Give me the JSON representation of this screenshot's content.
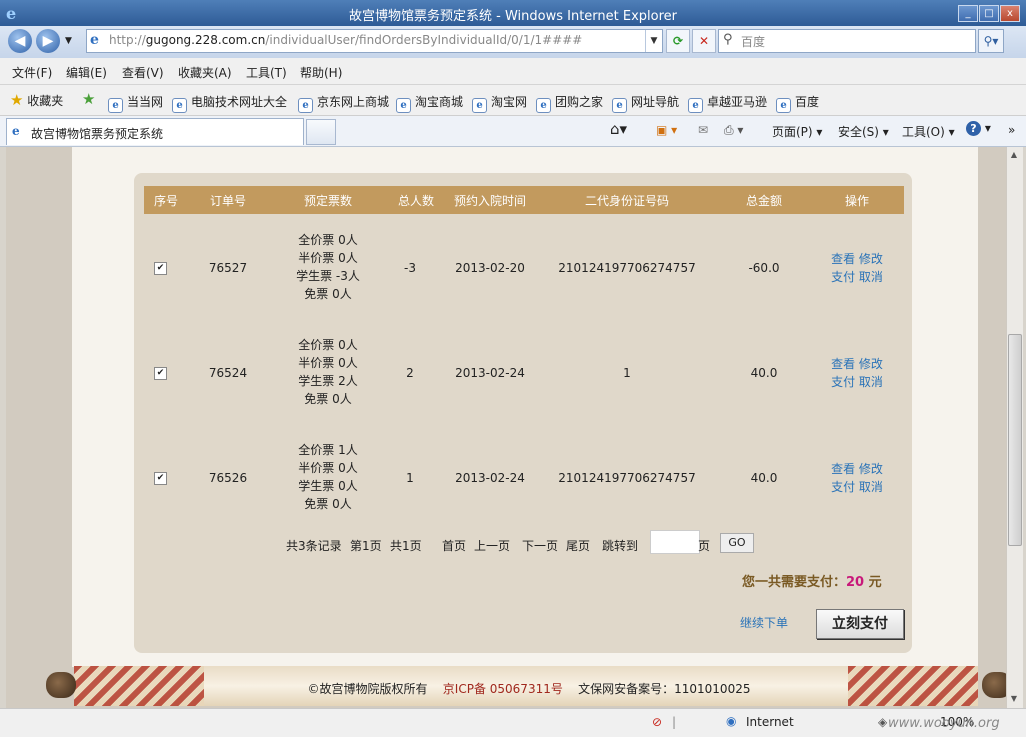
{
  "window": {
    "title": "故宫博物馆票务预定系统 - Windows Internet Explorer",
    "controls": [
      "_",
      "□",
      "x"
    ]
  },
  "address": {
    "url_prefix": "http://",
    "url_domain": "gugong.228.com.cn",
    "url_path": "/individualUser/findOrdersByIndividualId/0/1/1####",
    "search_placeholder": "百度"
  },
  "menu": [
    "文件(F)",
    "编辑(E)",
    "查看(V)",
    "收藏夹(A)",
    "工具(T)",
    "帮助(H)"
  ],
  "favorites": {
    "label": "收藏夹",
    "items": [
      "当当网",
      "电脑技术网址大全",
      "京东网上商城",
      "淘宝商城",
      "淘宝网",
      "团购之家",
      "网址导航",
      "卓越亚马逊",
      "百度"
    ]
  },
  "tab": {
    "label": "故宫博物馆票务预定系统"
  },
  "commands": {
    "page": "页面(P)",
    "safety": "安全(S)",
    "tools": "工具(O)",
    "help": "?"
  },
  "table": {
    "headers": [
      "序号",
      "订单号",
      "预定票数",
      "总人数",
      "预约入院时间",
      "二代身份证号码",
      "总金额",
      "操作"
    ],
    "rows": [
      {
        "checked": "✔",
        "order_no": "76527",
        "tickets": [
          "全价票 0人",
          "半价票 0人",
          "学生票 -3人",
          "免票 0人"
        ],
        "total_people": "-3",
        "date": "2013-02-20",
        "id_no": "210124197706274757",
        "amount": "-60.0",
        "actions": {
          "view": "查看",
          "edit": "修改",
          "pay": "支付",
          "cancel": "取消"
        }
      },
      {
        "checked": "✔",
        "order_no": "76524",
        "tickets": [
          "全价票 0人",
          "半价票 0人",
          "学生票 2人",
          "免票 0人"
        ],
        "total_people": "2",
        "date": "2013-02-24",
        "id_no": "1",
        "amount": "40.0",
        "actions": {
          "view": "查看",
          "edit": "修改",
          "pay": "支付",
          "cancel": "取消"
        }
      },
      {
        "checked": "✔",
        "order_no": "76526",
        "tickets": [
          "全价票 1人",
          "半价票 0人",
          "学生票 0人",
          "免票 0人"
        ],
        "total_people": "1",
        "date": "2013-02-24",
        "id_no": "210124197706274757",
        "amount": "40.0",
        "actions": {
          "view": "查看",
          "edit": "修改",
          "pay": "支付",
          "cancel": "取消"
        }
      }
    ]
  },
  "pagination": {
    "records": "共3条记录",
    "current": "第1页",
    "pages": "共1页",
    "first": "首页",
    "prev": "上一页",
    "next": "下一页",
    "last": "尾页",
    "jump_label": "跳转到",
    "page_unit": "页",
    "go": "GO"
  },
  "payment": {
    "total_label": "您一共需要支付：",
    "total_amount": "20",
    "currency": "元",
    "continue": "继续下单",
    "pay_now": "立刻支付"
  },
  "footer": {
    "copyright": "©故宫博物院版权所有",
    "icp": "京ICP备 05067311号",
    "record": "文保网安备案号：1101010025"
  },
  "status": {
    "zone": "Internet",
    "zoom": "100%"
  },
  "watermark": "www.wooyun.org"
}
